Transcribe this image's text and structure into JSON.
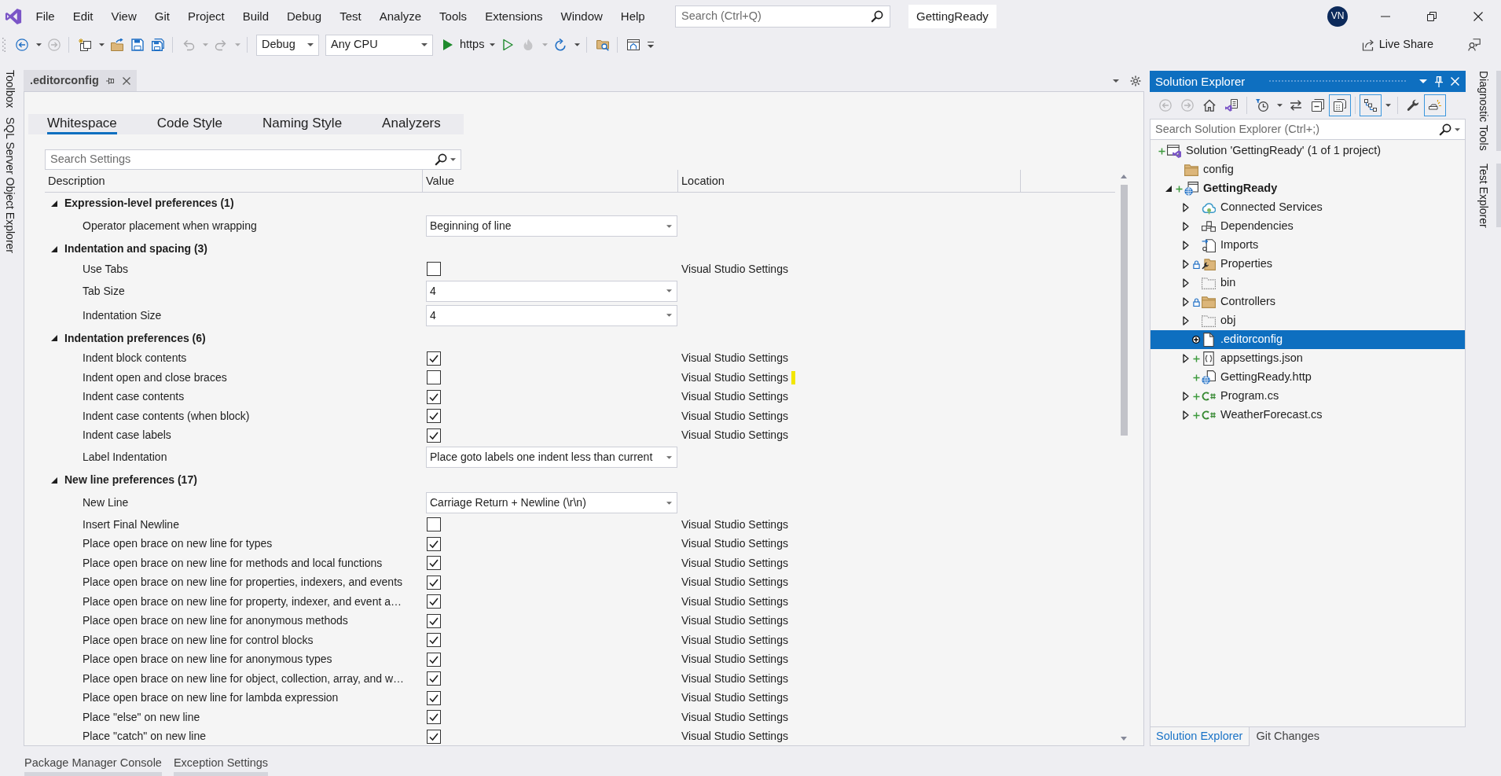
{
  "title_bar": {
    "menu": [
      "File",
      "Edit",
      "View",
      "Git",
      "Project",
      "Build",
      "Debug",
      "Test",
      "Analyze",
      "Tools",
      "Extensions",
      "Window",
      "Help"
    ],
    "search": {
      "placeholder": "Search (Ctrl+Q)"
    },
    "solution_name": "GettingReady",
    "account_initials": "VN"
  },
  "toolbar": {
    "items": [
      {
        "kind": "back",
        "disabled": false,
        "dropdown": true
      },
      {
        "kind": "forward",
        "disabled": true,
        "dropdown": false
      },
      {
        "kind": "separator"
      },
      {
        "kind": "new-item",
        "disabled": false,
        "dropdown": true
      },
      {
        "kind": "open",
        "disabled": false,
        "dropdown": false
      },
      {
        "kind": "save",
        "disabled": false,
        "dropdown": false
      },
      {
        "kind": "save-all",
        "disabled": false,
        "dropdown": false
      },
      {
        "kind": "separator"
      },
      {
        "kind": "undo",
        "disabled": true,
        "dropdown": true
      },
      {
        "kind": "redo",
        "disabled": true,
        "dropdown": true
      },
      {
        "kind": "separator"
      },
      {
        "kind": "combo",
        "value": "Debug"
      },
      {
        "kind": "combo",
        "value": "Any CPU"
      },
      {
        "kind": "run",
        "label": "https",
        "dropdown": true
      },
      {
        "kind": "run-outline",
        "disabled": false,
        "dropdown": false
      },
      {
        "kind": "hot-reload",
        "disabled": true,
        "dropdown": true
      },
      {
        "kind": "restart",
        "disabled": false,
        "dropdown": true
      },
      {
        "kind": "separator"
      },
      {
        "kind": "explorer",
        "disabled": false,
        "dropdown": false
      },
      {
        "kind": "separator"
      },
      {
        "kind": "layout",
        "disabled": false,
        "dropdown": false
      }
    ],
    "live_share": "Live Share"
  },
  "left_tool_tabs": [
    "Toolbox",
    "SQL Server Object Explorer"
  ],
  "editor": {
    "document_tab": {
      "title": ".editorconfig"
    },
    "settings_tabs": [
      {
        "label": "Whitespace",
        "selected": true
      },
      {
        "label": "Code Style",
        "selected": false
      },
      {
        "label": "Naming Style",
        "selected": false
      },
      {
        "label": "Analyzers",
        "selected": false
      }
    ],
    "search": {
      "placeholder": "Search Settings"
    },
    "columns": [
      "Description",
      "Value",
      "Location"
    ],
    "groups": [
      {
        "title": "Expression-level preferences (1)",
        "expanded": true,
        "rows": [
          {
            "kind": "dropdown",
            "label": "Operator placement when wrapping",
            "value": "Beginning of line",
            "marker": false
          }
        ]
      },
      {
        "title": "Indentation and spacing (3)",
        "expanded": true,
        "rows": [
          {
            "kind": "checkbox",
            "label": "Use Tabs",
            "checked": false,
            "location": "Visual Studio Settings",
            "marker": false
          },
          {
            "kind": "dropdown",
            "label": "Tab Size",
            "value": "4",
            "marker": false
          },
          {
            "kind": "dropdown",
            "label": "Indentation Size",
            "value": "4",
            "marker": false
          }
        ]
      },
      {
        "title": "Indentation preferences (6)",
        "expanded": true,
        "rows": [
          {
            "kind": "checkbox",
            "label": "Indent block contents",
            "checked": true,
            "location": "Visual Studio Settings",
            "marker": false
          },
          {
            "kind": "checkbox",
            "label": "Indent open and close braces",
            "checked": false,
            "location": "Visual Studio Settings",
            "marker": true
          },
          {
            "kind": "checkbox",
            "label": "Indent case contents",
            "checked": true,
            "location": "Visual Studio Settings",
            "marker": false
          },
          {
            "kind": "checkbox",
            "label": "Indent case contents (when block)",
            "checked": true,
            "location": "Visual Studio Settings",
            "marker": false
          },
          {
            "kind": "checkbox",
            "label": "Indent case labels",
            "checked": true,
            "location": "Visual Studio Settings",
            "marker": false
          },
          {
            "kind": "dropdown",
            "label": "Label Indentation",
            "value": "Place goto labels one indent less than current",
            "marker": false
          }
        ]
      },
      {
        "title": "New line preferences (17)",
        "expanded": true,
        "rows": [
          {
            "kind": "dropdown",
            "label": "New Line",
            "value": "Carriage Return + Newline (\\r\\n)",
            "marker": false
          },
          {
            "kind": "checkbox",
            "label": "Insert Final Newline",
            "checked": false,
            "location": "Visual Studio Settings",
            "marker": false
          },
          {
            "kind": "checkbox",
            "label": "Place open brace on new line for types",
            "checked": true,
            "location": "Visual Studio Settings",
            "marker": false
          },
          {
            "kind": "checkbox",
            "label": "Place open brace on new line for methods and local functions",
            "checked": true,
            "location": "Visual Studio Settings",
            "marker": false
          },
          {
            "kind": "checkbox",
            "label": "Place open brace on new line for properties, indexers, and events",
            "checked": true,
            "location": "Visual Studio Settings",
            "marker": false
          },
          {
            "kind": "checkbox",
            "label": "Place open brace on new line for property, indexer, and event a…",
            "checked": true,
            "location": "Visual Studio Settings",
            "marker": false
          },
          {
            "kind": "checkbox",
            "label": "Place open brace on new line for anonymous methods",
            "checked": true,
            "location": "Visual Studio Settings",
            "marker": false
          },
          {
            "kind": "checkbox",
            "label": "Place open brace on new line for control blocks",
            "checked": true,
            "location": "Visual Studio Settings",
            "marker": false
          },
          {
            "kind": "checkbox",
            "label": "Place open brace on new line for anonymous types",
            "checked": true,
            "location": "Visual Studio Settings",
            "marker": false
          },
          {
            "kind": "checkbox",
            "label": "Place open brace on new line for object, collection, array, and w…",
            "checked": true,
            "location": "Visual Studio Settings",
            "marker": false
          },
          {
            "kind": "checkbox",
            "label": "Place open brace on new line for lambda expression",
            "checked": true,
            "location": "Visual Studio Settings",
            "marker": false
          },
          {
            "kind": "checkbox",
            "label": "Place \"else\" on new line",
            "checked": true,
            "location": "Visual Studio Settings",
            "marker": false
          },
          {
            "kind": "checkbox",
            "label": "Place \"catch\" on new line",
            "checked": true,
            "location": "Visual Studio Settings",
            "marker": false
          }
        ]
      }
    ]
  },
  "solution_explorer": {
    "title": "Solution Explorer",
    "toolbar": [
      {
        "kind": "back",
        "disabled": true,
        "on": false,
        "dropdown": false
      },
      {
        "kind": "forward",
        "disabled": true,
        "on": false,
        "dropdown": false
      },
      {
        "kind": "home",
        "disabled": false,
        "on": false,
        "dropdown": false
      },
      {
        "kind": "switch-views",
        "disabled": false,
        "on": false,
        "dropdown": false
      },
      {
        "kind": "separator"
      },
      {
        "kind": "pending-filter",
        "disabled": false,
        "on": false,
        "dropdown": true
      },
      {
        "kind": "sync",
        "disabled": false,
        "on": false,
        "dropdown": false
      },
      {
        "kind": "collapse",
        "disabled": false,
        "on": false,
        "dropdown": false
      },
      {
        "kind": "show-all",
        "disabled": false,
        "on": true,
        "dropdown": false
      },
      {
        "kind": "separator"
      },
      {
        "kind": "tree-view",
        "disabled": false,
        "on": true,
        "dropdown": true
      },
      {
        "kind": "separator"
      },
      {
        "kind": "properties",
        "disabled": false,
        "on": false,
        "dropdown": false
      },
      {
        "kind": "preview",
        "disabled": false,
        "on": true,
        "dropdown": false
      }
    ],
    "search": {
      "placeholder": "Search Solution Explorer (Ctrl+;)"
    },
    "tree": [
      {
        "label": "Solution 'GettingReady' (1 of 1 project)",
        "kind": "solution",
        "added": true,
        "locked": false,
        "selected": false,
        "children": [
          {
            "label": "config",
            "kind": "folder",
            "added": false,
            "locked": false,
            "selected": false
          },
          {
            "label": "GettingReady",
            "kind": "project",
            "added": true,
            "locked": false,
            "expanded": true,
            "selected": false,
            "children": [
              {
                "label": "Connected Services",
                "kind": "connected-services",
                "added": false,
                "locked": false,
                "expanded": false,
                "selected": false
              },
              {
                "label": "Dependencies",
                "kind": "dependencies",
                "added": false,
                "locked": false,
                "expanded": false,
                "selected": false
              },
              {
                "label": "Imports",
                "kind": "imports",
                "added": false,
                "locked": false,
                "expanded": false,
                "selected": false
              },
              {
                "label": "Properties",
                "kind": "properties",
                "added": false,
                "locked": true,
                "expanded": false,
                "selected": false
              },
              {
                "label": "bin",
                "kind": "excluded-folder",
                "added": false,
                "locked": false,
                "expanded": false,
                "selected": false
              },
              {
                "label": "Controllers",
                "kind": "folder",
                "added": false,
                "locked": true,
                "expanded": false,
                "selected": false
              },
              {
                "label": "obj",
                "kind": "excluded-folder",
                "added": false,
                "locked": false,
                "expanded": false,
                "selected": false
              },
              {
                "label": ".editorconfig",
                "kind": "file",
                "added": true,
                "locked": false,
                "selected": true
              },
              {
                "label": "appsettings.json",
                "kind": "json",
                "added": true,
                "locked": false,
                "expanded": false,
                "selected": false
              },
              {
                "label": "GettingReady.http",
                "kind": "http",
                "added": true,
                "locked": false,
                "selected": false
              },
              {
                "label": "Program.cs",
                "kind": "csharp",
                "added": true,
                "locked": false,
                "expanded": false,
                "selected": false
              },
              {
                "label": "WeatherForecast.cs",
                "kind": "csharp",
                "added": true,
                "locked": false,
                "expanded": false,
                "selected": false
              }
            ]
          }
        ]
      }
    ],
    "bottom_tabs": [
      {
        "label": "Solution Explorer",
        "selected": true
      },
      {
        "label": "Git Changes",
        "selected": false
      }
    ]
  },
  "right_tool_tabs": [
    "Diagnostic Tools",
    "Test Explorer"
  ],
  "bottom_tool_tabs": [
    "Package Manager Console",
    "Exception Settings"
  ]
}
